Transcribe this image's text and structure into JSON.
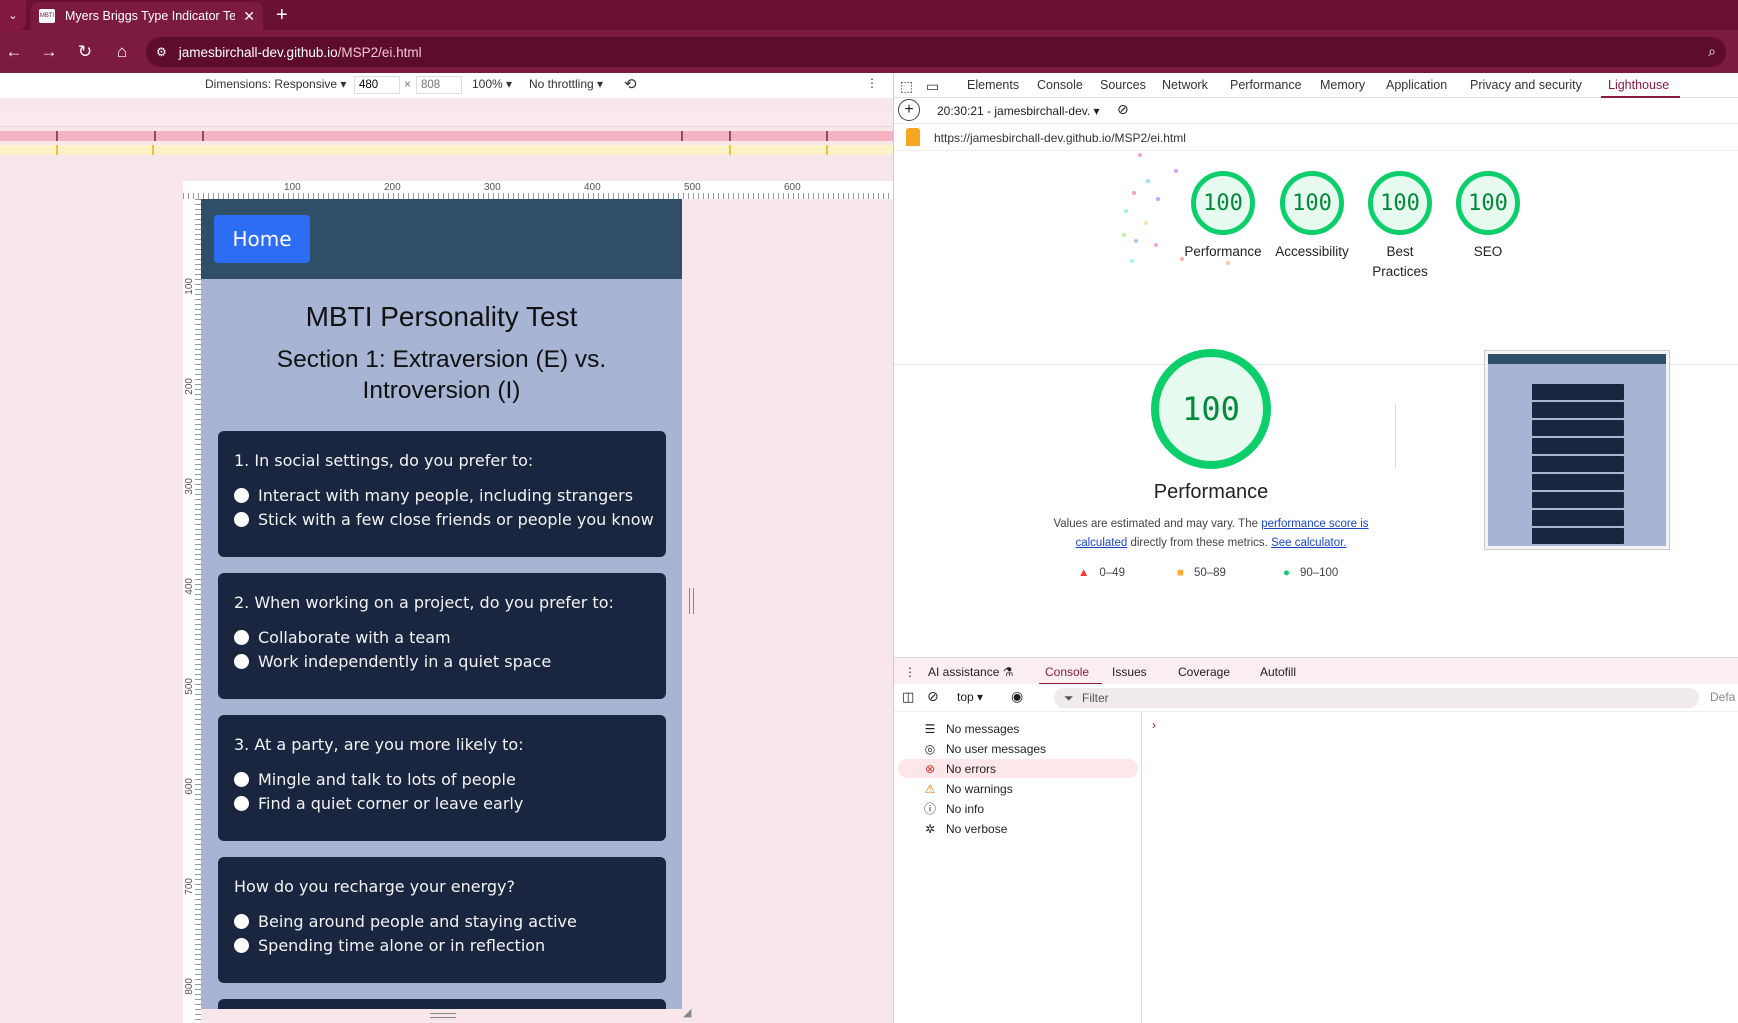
{
  "browser": {
    "tab_title": "Myers Briggs Type Indicator Tes",
    "favicon_text": "MBTI",
    "url_host": "jamesbirchall-dev.github.io",
    "url_path": "/MSP2/ei.html"
  },
  "device_toolbar": {
    "dimensions_label": "Dimensions: Responsive",
    "width": "480",
    "height_placeholder": "808",
    "times": "×",
    "zoom": "100%",
    "throttling": "No throttling"
  },
  "ruler": {
    "top_labels": [
      "100",
      "200",
      "300",
      "400",
      "500",
      "600"
    ],
    "left_labels": [
      "100",
      "200",
      "300",
      "400",
      "500",
      "600",
      "700",
      "800"
    ]
  },
  "page": {
    "home_button": "Home",
    "title": "MBTI Personality Test",
    "section_title": "Section 1: Extraversion (E) vs. Introversion (I)",
    "questions": [
      {
        "text": "1. In social settings, do you prefer to:",
        "options": [
          "Interact with many people, including strangers",
          "Stick with a few close friends or people you know"
        ]
      },
      {
        "text": "2. When working on a project, do you prefer to:",
        "options": [
          "Collaborate with a team",
          "Work independently in a quiet space"
        ]
      },
      {
        "text": "3. At a party, are you more likely to:",
        "options": [
          "Mingle and talk to lots of people",
          "Find a quiet corner or leave early"
        ]
      },
      {
        "text": "How do you recharge your energy?",
        "options": [
          "Being around people and staying active",
          "Spending time alone or in reflection"
        ]
      }
    ]
  },
  "devtools": {
    "tabs": [
      "Elements",
      "Console",
      "Sources",
      "Network",
      "Performance",
      "Memory",
      "Application",
      "Privacy and security",
      "Lighthouse"
    ],
    "active_tab": "Lighthouse",
    "report_selector": "20:30:21 - jamesbirchall-dev.",
    "report_url": "https://jamesbirchall-dev.github.io/MSP2/ei.html",
    "scores": [
      {
        "value": "100",
        "label": "Performance"
      },
      {
        "value": "100",
        "label": "Accessibility"
      },
      {
        "value": "100",
        "label": "Best Practices"
      },
      {
        "value": "100",
        "label": "SEO"
      }
    ],
    "main_score": "100",
    "main_label": "Performance",
    "note_prefix": "Values are estimated and may vary. The ",
    "note_link1": "performance score is calculated",
    "note_mid": " directly from these metrics. ",
    "note_link2": "See calculator.",
    "legend": [
      {
        "range": "0–49",
        "color": "#ff3333"
      },
      {
        "range": "50–89",
        "color": "#ffaa33"
      },
      {
        "range": "90–100",
        "color": "#0cce6b"
      }
    ],
    "drawer_tabs": [
      "AI assistance",
      "Console",
      "Issues",
      "Coverage",
      "Autofill"
    ],
    "drawer_active": "Console",
    "context": "top",
    "filter_placeholder": "Filter",
    "default_levels": "Defa",
    "sidebar": [
      {
        "label": "No messages",
        "icon": "list-icon"
      },
      {
        "label": "No user messages",
        "icon": "user-icon"
      },
      {
        "label": "No errors",
        "icon": "error-icon"
      },
      {
        "label": "No warnings",
        "icon": "warning-icon"
      },
      {
        "label": "No info",
        "icon": "info-icon"
      },
      {
        "label": "No verbose",
        "icon": "bug-icon"
      }
    ],
    "prompt": "›"
  }
}
